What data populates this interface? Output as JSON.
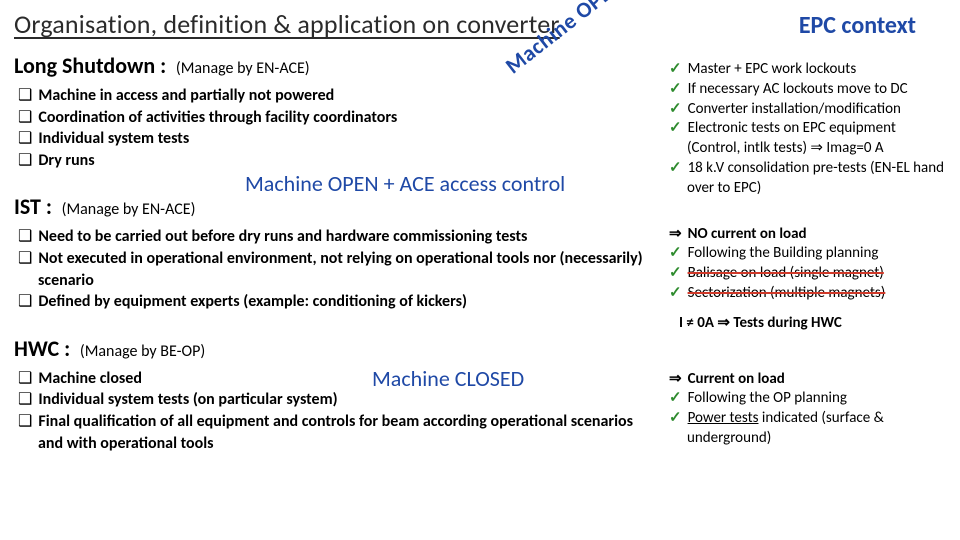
{
  "title": {
    "left": "Organisation, definition & application on converter",
    "right": "EPC context"
  },
  "diagonal": "Machine OPEN",
  "longShutdown": {
    "heading": "Long Shutdown :",
    "manager": "(Manage by EN-ACE)",
    "items": [
      "Machine in access and partially not powered",
      "Coordination of activities through facility coordinators",
      "Individual system tests",
      "Dry runs"
    ]
  },
  "ist": {
    "heading": "IST :",
    "manager": "(Manage by EN-ACE)",
    "banner": "Machine OPEN + ACE access control",
    "items": [
      "Need to be carried out before dry runs and hardware commissioning tests",
      "Not executed in operational environment, not relying on operational tools nor (necessarily) scenario",
      "Defined by equipment experts (example: conditioning of kickers)"
    ]
  },
  "hwc": {
    "heading": "HWC :",
    "manager": "(Manage by BE-OP)",
    "banner": "Machine CLOSED",
    "items": [
      "Machine closed",
      "Individual system tests (on particular system)",
      "Final qualification of all equipment and controls for beam according operational scenarios and with operational tools"
    ]
  },
  "epc": {
    "top": [
      "Master + EPC work lockouts",
      "If necessary AC lockouts move to DC",
      "Converter installation/modification",
      "Electronic tests on EPC equipment (Control, intlk tests)  ⇒  Imag=0 A",
      "18 k.V consolidation pre-tests     (EN-EL hand over to EPC)"
    ],
    "mid": {
      "imply": "NO current on load",
      "items": [
        "Following the Building planning",
        "Balisage on load (single magnet)",
        "Sectorization (multiple magnets)"
      ],
      "note_prefix": "I ≠ 0A ",
      "note_suffix": " Tests during HWC"
    },
    "bot": {
      "imply": "Current on load",
      "items_plain": "Following the OP planning",
      "items_rich_pre": "Power tests",
      "items_rich_post": " indicated (surface & underground)"
    }
  }
}
